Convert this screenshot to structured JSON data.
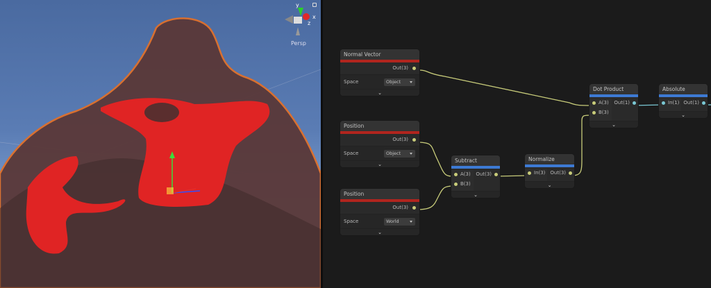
{
  "viewport": {
    "gizmo": {
      "x_label": "x",
      "y_label": "y",
      "z_label": "z",
      "projection": "Persp"
    }
  },
  "nodes": {
    "normal_vector": {
      "title": "Normal Vector",
      "out": "Out(3)",
      "space_label": "Space",
      "space_value": "Object"
    },
    "position1": {
      "title": "Position",
      "out": "Out(3)",
      "space_label": "Space",
      "space_value": "Object"
    },
    "position2": {
      "title": "Position",
      "out": "Out(3)",
      "space_label": "Space",
      "space_value": "World"
    },
    "subtract": {
      "title": "Subtract",
      "in_a": "A(3)",
      "in_b": "B(3)",
      "out": "Out(3)"
    },
    "normalize": {
      "title": "Normalize",
      "in": "In(3)",
      "out": "Out(3)"
    },
    "dot_product": {
      "title": "Dot Product",
      "in_a": "A(3)",
      "in_b": "B(3)",
      "out": "Out(1)"
    },
    "absolute": {
      "title": "Absolute",
      "in": "In(1)",
      "out": "Out(1)"
    }
  },
  "colors": {
    "vector3_wire": "#c8cc7a",
    "float_wire": "#7ac8d4",
    "input_stripe": "#b1251e",
    "math_stripe": "#3d7ad4"
  }
}
